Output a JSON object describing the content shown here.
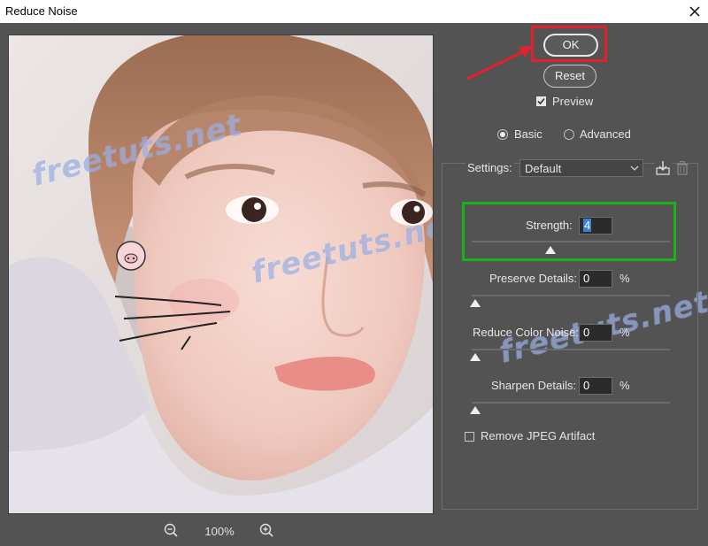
{
  "window": {
    "title": "Reduce Noise",
    "close_icon": "close-icon"
  },
  "buttons": {
    "ok_label": "OK",
    "reset_label": "Reset"
  },
  "preview_toggle": {
    "label": "Preview",
    "checked": true
  },
  "mode": {
    "basic_label": "Basic",
    "advanced_label": "Advanced",
    "selected": "Basic"
  },
  "settings": {
    "label": "Settings:",
    "value": "Default",
    "save_icon": "save-preset-icon",
    "delete_icon": "trash-icon"
  },
  "controls": {
    "strength": {
      "label": "Strength:",
      "value": "4",
      "position": 0.4
    },
    "preserve_details": {
      "label": "Preserve Details:",
      "value": "0",
      "unit": "%",
      "position": 0
    },
    "reduce_color_noise": {
      "label": "Reduce Color Noise:",
      "value": "0",
      "unit": "%",
      "position": 0
    },
    "sharpen_details": {
      "label": "Sharpen Details:",
      "value": "0",
      "unit": "%",
      "position": 0
    }
  },
  "remove_jpeg_artifact": {
    "label": "Remove JPEG Artifact",
    "checked": false
  },
  "zoom": {
    "value": "100%",
    "zoom_out_icon": "zoom-out-icon",
    "zoom_in_icon": "zoom-in-icon"
  },
  "watermark": {
    "text": "freetuts.net"
  },
  "colors": {
    "ok_highlight": "#e3202e",
    "strength_highlight": "#19b319",
    "background": "#535353"
  }
}
